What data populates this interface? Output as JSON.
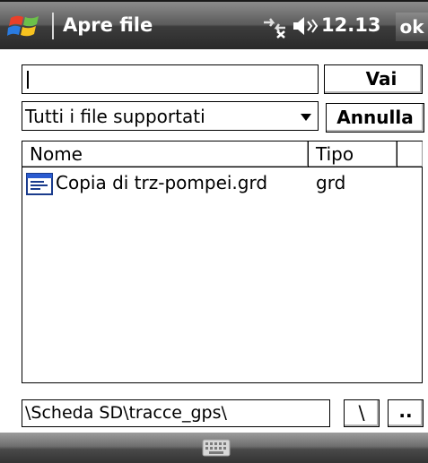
{
  "titlebar": {
    "title": "Apre file",
    "clock": "12.13",
    "ok_label": "ok",
    "icons": [
      "windows-flag-icon",
      "connectivity-icon",
      "volume-icon"
    ]
  },
  "dialog": {
    "filename_value": "",
    "go_label": "Vai",
    "filter_selected": "Tutti i file supportati",
    "cancel_label": "Annulla"
  },
  "file_list": {
    "columns": [
      "Nome",
      "Tipo",
      ""
    ],
    "rows": [
      {
        "name": "Copia di trz-pompei.grd",
        "type": "grd",
        "icon": "document-icon"
      }
    ]
  },
  "path_bar": {
    "path": "\\Scheda SD\\tracce_gps\\",
    "root_label": "\\",
    "up_label": ".."
  },
  "menubar": {
    "icons": [
      "keyboard-icon"
    ]
  },
  "colors": {
    "titlebar_top": "#8c8c8c",
    "titlebar_bottom": "#2a2a2a",
    "background": "#ffffff",
    "border": "#000000",
    "windows_red": "#e8402a",
    "windows_green": "#6cc04a",
    "windows_blue": "#2a7be0",
    "windows_yellow": "#f7c21f"
  }
}
